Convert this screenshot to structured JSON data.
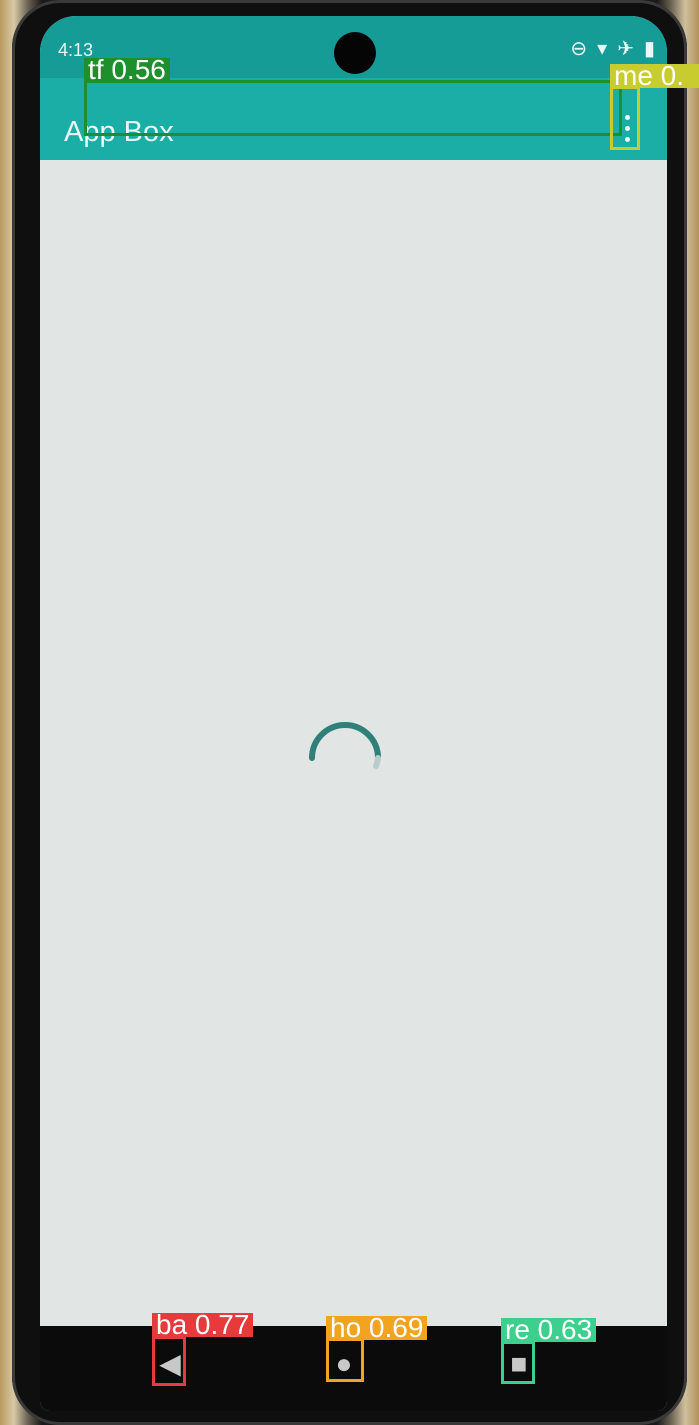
{
  "status_bar": {
    "time": "4:13",
    "icons": [
      "do-not-disturb-icon",
      "wifi-icon",
      "airplane-icon",
      "battery-icon"
    ]
  },
  "app_bar": {
    "title": "App Box",
    "overflow_icon": "more-vert-icon"
  },
  "content": {
    "loading_indicator": "spinner"
  },
  "navigation_bar": {
    "back_icon": "back-icon",
    "home_icon": "home-icon",
    "recent_icon": "recent-apps-icon"
  },
  "detections": [
    {
      "label": "tf 0.56",
      "color": "#1f8f2e"
    },
    {
      "label": "me 0.",
      "color": "#c8cc2f"
    },
    {
      "label": "ba 0.77",
      "color": "#e63a3d"
    },
    {
      "label": "ho 0.69",
      "color": "#f2a421"
    },
    {
      "label": "re 0.63",
      "color": "#3ccf8d"
    }
  ]
}
